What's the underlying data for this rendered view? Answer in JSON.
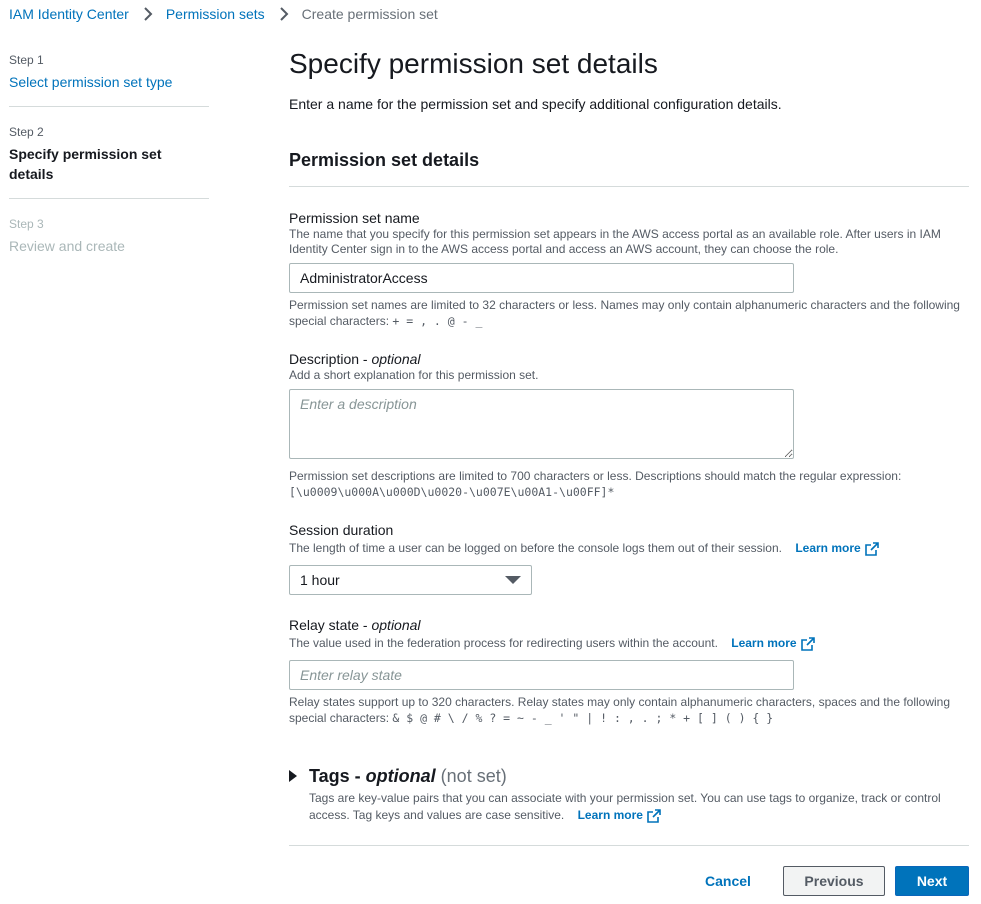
{
  "breadcrumb": {
    "items": [
      "IAM Identity Center",
      "Permission sets"
    ],
    "current": "Create permission set"
  },
  "steps": [
    {
      "num": "Step 1",
      "title": "Select permission set type",
      "state": "done"
    },
    {
      "num": "Step 2",
      "title": "Specify permission set details",
      "state": "active"
    },
    {
      "num": "Step 3",
      "title": "Review and create",
      "state": "disabled"
    }
  ],
  "page": {
    "title": "Specify permission set details",
    "description": "Enter a name for the permission set and specify additional configuration details."
  },
  "section": {
    "title": "Permission set details"
  },
  "name_field": {
    "label": "Permission set name",
    "description": "The name that you specify for this permission set appears in the AWS access portal as an available role. After users in IAM Identity Center sign in to the AWS access portal and access an AWS account, they can choose the role.",
    "value": "AdministratorAccess",
    "constraint": "Permission set names are limited to 32 characters or less. Names may only contain alphanumeric characters and the following special characters:",
    "constraint_chars": "+ = , . @ - _"
  },
  "description_field": {
    "label": "Description - ",
    "label_optional": "optional",
    "description": "Add a short explanation for this permission set.",
    "placeholder": "Enter a description",
    "constraint": "Permission set descriptions are limited to 700 characters or less. Descriptions should match the regular expression:",
    "constraint_regex": "[\\u0009\\u000A\\u000D\\u0020-\\u007E\\u00A1-\\u00FF]*"
  },
  "session_field": {
    "label": "Session duration",
    "description": "The length of time a user can be logged on before the console logs them out of their session.",
    "learn_more": "Learn more",
    "selected": "1 hour"
  },
  "relay_field": {
    "label": "Relay state - ",
    "label_optional": "optional",
    "description": "The value used in the federation process for redirecting users within the account.",
    "learn_more": "Learn more",
    "placeholder": "Enter relay state",
    "constraint": "Relay states support up to 320 characters. Relay states may only contain alphanumeric characters, spaces and the following special characters:",
    "constraint_chars": "& $ @ # \\ / % ? = ~ - _ ' \" | ! : , . ; * + [ ] ( ) { }"
  },
  "tags": {
    "title": "Tags - ",
    "title_optional": "optional",
    "status": "(not set)",
    "description": "Tags are key-value pairs that you can associate with your permission set. You can use tags to organize, track or control access. Tag keys and values are case sensitive.",
    "learn_more": "Learn more"
  },
  "buttons": {
    "cancel": "Cancel",
    "previous": "Previous",
    "next": "Next"
  },
  "colors": {
    "link": "#0073bb",
    "primary": "#0073bb",
    "text": "#16191f",
    "muted": "#545b64",
    "divider": "#d5dbdb"
  },
  "icons": [
    "chevron-right-icon",
    "external-link-icon",
    "caret-down-icon",
    "caret-right-icon"
  ]
}
